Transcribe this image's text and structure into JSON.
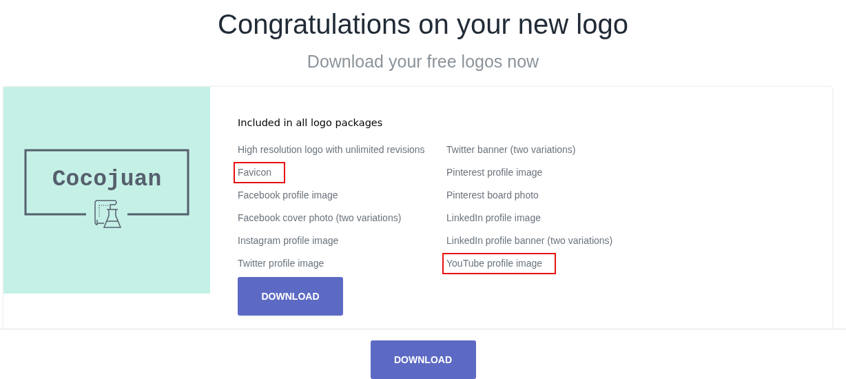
{
  "heading": "Congratulations on your new logo",
  "subheading": "Download your free logos now",
  "logo": {
    "wordmark": "Cocojuan"
  },
  "package": {
    "title": "Included in all logo packages",
    "columns": [
      [
        {
          "label": "High resolution logo with unlimited revisions",
          "highlighted": false
        },
        {
          "label": "Favicon",
          "highlighted": true
        },
        {
          "label": "Facebook profile image",
          "highlighted": false
        },
        {
          "label": "Facebook cover photo (two variations)",
          "highlighted": false
        },
        {
          "label": "Instagram profile image",
          "highlighted": false
        },
        {
          "label": "Twitter profile image",
          "highlighted": false
        }
      ],
      [
        {
          "label": "Twitter banner (two variations)",
          "highlighted": false
        },
        {
          "label": "Pinterest profile image",
          "highlighted": false
        },
        {
          "label": "Pinterest board photo",
          "highlighted": false
        },
        {
          "label": "LinkedIn profile image",
          "highlighted": false
        },
        {
          "label": "LinkedIn profile banner (two variations)",
          "highlighted": false
        },
        {
          "label": "YouTube profile image",
          "highlighted": true
        }
      ]
    ],
    "button": "DOWNLOAD"
  },
  "footer": {
    "button": "DOWNLOAD"
  }
}
